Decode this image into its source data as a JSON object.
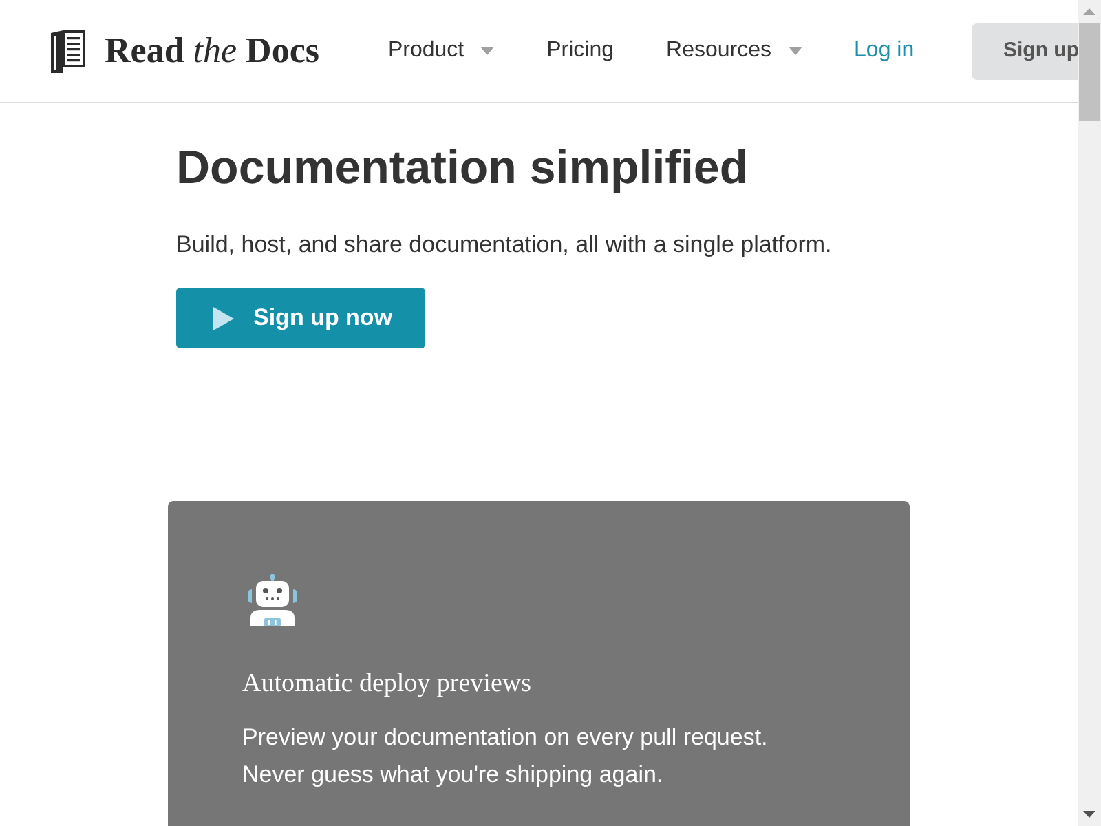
{
  "header": {
    "logo": "Read *the* Docs",
    "nav": [
      {
        "label": "Product",
        "dropdown": true
      },
      {
        "label": "Pricing",
        "dropdown": false
      },
      {
        "label": "Resources",
        "dropdown": true
      }
    ],
    "login": "Log in",
    "signup": "Sign up"
  },
  "hero": {
    "title": "Documentation simplified",
    "subtitle": "Build, host, and share documentation, all with a single platform.",
    "cta": "Sign up now"
  },
  "feature": {
    "title": "Automatic deploy previews",
    "description": "Preview your documentation on every pull request. Never guess what you're shipping again."
  }
}
